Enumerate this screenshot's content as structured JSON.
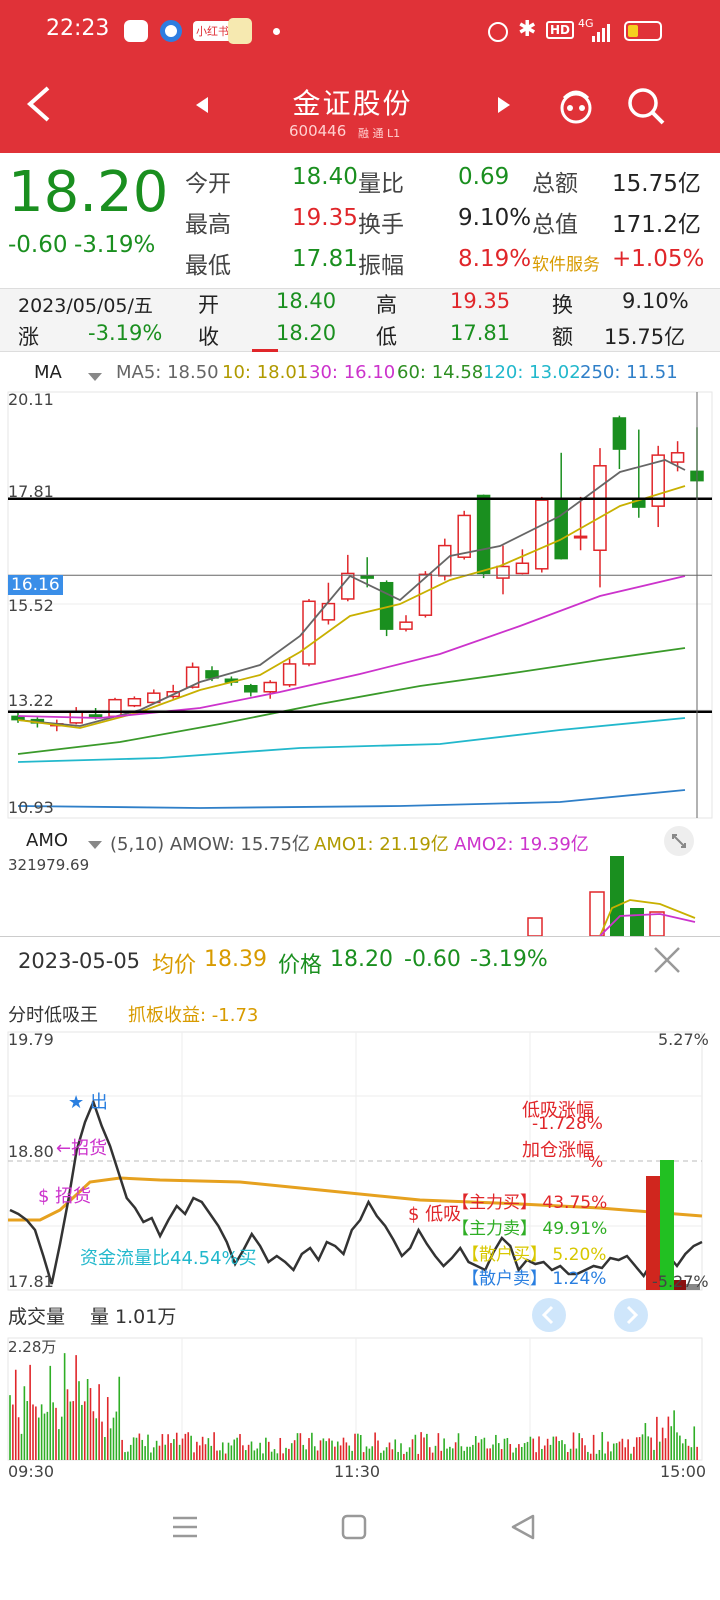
{
  "status_bar": {
    "time": "22:23",
    "badge": "小红书",
    "network": "4G"
  },
  "header": {
    "title": "金证股份",
    "code": "600446",
    "tag": "融 通 L1"
  },
  "quote": {
    "price": "18.20",
    "change": "-0.60",
    "change_pct": "-3.19%",
    "rows": [
      [
        {
          "label": "今开",
          "value": "18.40",
          "color": "#1a8f1f"
        },
        {
          "label": "量比",
          "value": "0.69",
          "color": "#1a8f1f"
        },
        {
          "label": "总额",
          "value": "15.75亿",
          "color": "#222"
        }
      ],
      [
        {
          "label": "最高",
          "value": "19.35",
          "color": "#e0262a"
        },
        {
          "label": "换手",
          "value": "9.10%",
          "color": "#222"
        },
        {
          "label": "总值",
          "value": "171.2亿",
          "color": "#222"
        }
      ],
      [
        {
          "label": "最低",
          "value": "17.81",
          "color": "#1a8f1f"
        },
        {
          "label": "振幅",
          "value": "8.19%",
          "color": "#e0262a"
        },
        {
          "label": "软件服务",
          "value": "+1.05%",
          "color": "#e0262a"
        }
      ]
    ]
  },
  "summary": {
    "date": "2023/05/05/五",
    "open_label": "开",
    "open": "18.40",
    "high_label": "高",
    "high": "19.35",
    "turn_label": "换",
    "turn": "9.10%",
    "chg_label": "涨",
    "chg": "-3.19%",
    "close_label": "收",
    "close": "18.20",
    "low_label": "低",
    "low": "17.81",
    "amt_label": "额",
    "amt": "15.75亿"
  },
  "ma_legend": {
    "name": "MA",
    "ma5": "MA5: 18.50",
    "ma10": "10: 18.01",
    "ma30": "30: 16.10",
    "ma60": "60: 14.58",
    "ma120": "120: 13.02",
    "ma250": "250: 11.51"
  },
  "kline_axis": {
    "top": "20.11",
    "h1": "17.81",
    "cross": "16.16",
    "l1": "15.52",
    "h2": "13.22",
    "bottom": "10.93"
  },
  "amo_legend": {
    "name": "AMO",
    "params": "(5,10) AMOW: 15.75亿",
    "amo1": "AMO1: 21.19亿",
    "amo2": "AMO2: 19.39亿",
    "top": "321979.69"
  },
  "popup": {
    "date": "2023-05-05",
    "avg_label": "均价",
    "avg": "18.39",
    "price_label": "价格",
    "price": "18.20",
    "chg": "-0.60",
    "chg_pct": "-3.19%",
    "indicator": "分时低吸王",
    "profit": "抓板收益: -1.73",
    "y_top": "19.79",
    "y_mid": "18.80",
    "y_bot": "17.81",
    "pct_top": "5.27%",
    "pct_bot": "-5.27%",
    "sig_out": "★ 出",
    "sig_recruit1": "←招货",
    "sig_recruit2": "$ 招货",
    "flow": "资金流量比44.54%买",
    "dip": "$ 低吸",
    "dip_gain_label": "低吸涨幅",
    "dip_gain": "-1.728%",
    "add_gain_label": "加仓涨幅",
    "add_gain": "%",
    "main_buy": "【主力买】 43.75%",
    "main_sell": "【主力卖】 49.91%",
    "retail_buy": "【散户买】 5.20%",
    "retail_sell": "【散户卖】 1.24%",
    "vol_label": "成交量",
    "vol": "量 1.01万",
    "vol_top": "2.28万",
    "t_start": "09:30",
    "t_mid": "11:30",
    "t_end": "15:00"
  },
  "colors": {
    "header": "#e03238",
    "up": "#e0262a",
    "down": "#1a8f1f",
    "ma5": "#666666",
    "ma10": "#c8b000",
    "ma30": "#cc33cc",
    "ma60": "#3a9a2a",
    "ma120": "#22b8cc",
    "ma250": "#2f7fc8"
  }
}
